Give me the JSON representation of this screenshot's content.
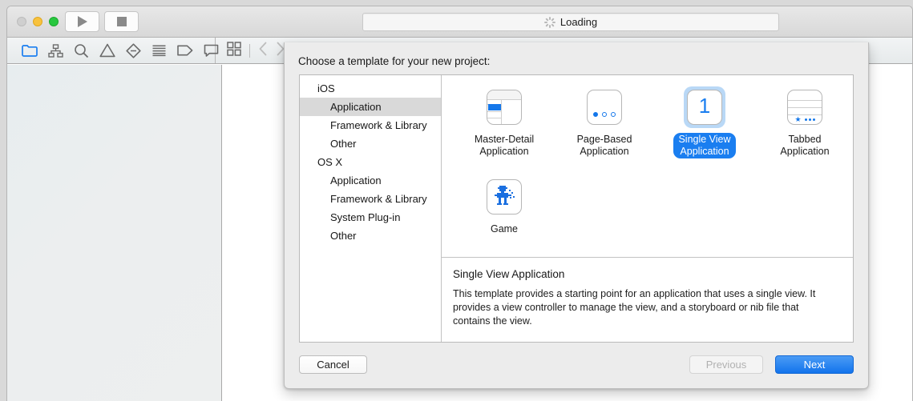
{
  "window": {
    "traffic_lights": [
      "close",
      "minimize",
      "zoom"
    ],
    "run_button": "run-icon",
    "stop_button": "stop-icon",
    "status": {
      "icon": "loading-spinner-icon",
      "text": "Loading"
    },
    "navigator_icons": [
      "project-navigator-icon",
      "source-control-navigator-icon",
      "find-navigator-icon",
      "issue-navigator-icon",
      "test-navigator-icon",
      "debug-navigator-icon",
      "breakpoint-navigator-icon",
      "report-navigator-icon"
    ],
    "editor_icons": [
      "assistant-editor-icon",
      "back-chevron-icon",
      "forward-chevron-icon"
    ]
  },
  "sheet": {
    "title": "Choose a template for your new project:",
    "sidebar": [
      {
        "label": "iOS",
        "type": "group",
        "selected": false
      },
      {
        "label": "Application",
        "type": "child",
        "selected": true
      },
      {
        "label": "Framework & Library",
        "type": "child",
        "selected": false
      },
      {
        "label": "Other",
        "type": "child",
        "selected": false
      },
      {
        "label": "OS X",
        "type": "group",
        "selected": false
      },
      {
        "label": "Application",
        "type": "child",
        "selected": false
      },
      {
        "label": "Framework & Library",
        "type": "child",
        "selected": false
      },
      {
        "label": "System Plug-in",
        "type": "child",
        "selected": false
      },
      {
        "label": "Other",
        "type": "child",
        "selected": false
      }
    ],
    "templates": [
      {
        "label": "Master-Detail\nApplication",
        "icon": "master-detail-icon",
        "selected": false
      },
      {
        "label": "Page-Based\nApplication",
        "icon": "page-based-icon",
        "selected": false
      },
      {
        "label": "Single View\nApplication",
        "icon": "single-view-icon",
        "selected": true
      },
      {
        "label": "Tabbed\nApplication",
        "icon": "tabbed-icon",
        "selected": false
      },
      {
        "label": "Game",
        "icon": "game-icon",
        "selected": false
      }
    ],
    "description": {
      "title": "Single View Application",
      "body": "This template provides a starting point for an application that uses a single view. It provides a view controller to manage the view, and a storyboard or nib file that contains the view."
    },
    "buttons": {
      "cancel": "Cancel",
      "previous": "Previous",
      "next": "Next"
    }
  },
  "colors": {
    "accent_blue": "#1a7ef0",
    "selection_gray": "#d9d9d9",
    "icon_blue": "#1477ea",
    "sheet_bg": "#ececec"
  }
}
